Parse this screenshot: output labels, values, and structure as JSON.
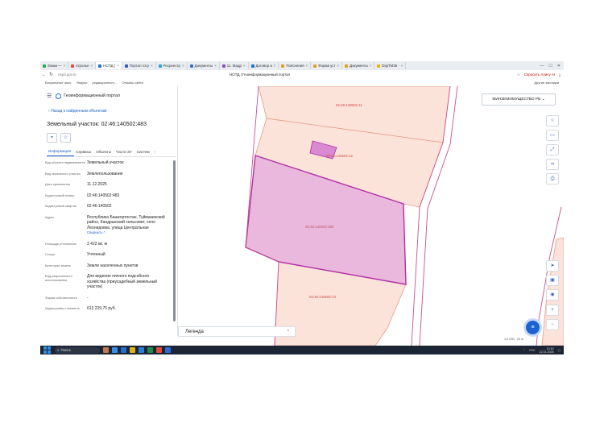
{
  "browser": {
    "tabs": [
      {
        "label": "Знаки —",
        "color": "#2ca84a",
        "active": false
      },
      {
        "label": "нтрольн",
        "color": "#e44b3a",
        "active": false
      },
      {
        "label": "НСПД |",
        "color": "#1e6fd0",
        "active": true
      },
      {
        "label": "Портал госу",
        "color": "#2d5fb8",
        "active": false
      },
      {
        "label": "Росреестр",
        "color": "#2d9ee0",
        "active": false
      },
      {
        "label": "Документы",
        "color": "#3a6fc4",
        "active": false
      },
      {
        "label": "11. Мадр",
        "color": "#8a4fc4",
        "active": false
      },
      {
        "label": "Договор а",
        "color": "#1e6fd0",
        "active": false
      },
      {
        "label": "Пояснения",
        "color": "#e0a21c",
        "active": false
      },
      {
        "label": "Форма уст",
        "color": "#e0a21c",
        "active": false
      },
      {
        "label": "Документы",
        "color": "#e0a21c",
        "active": false
      },
      {
        "label": "DigiTM38 ·",
        "color": "#f0b400",
        "active": false
      }
    ],
    "url": "nspd.gov.ru",
    "page_title": "НСПД | Геоинформационный портал",
    "alice": "Спросить Алису AI",
    "bookmarks": [
      "Визуальные закл.",
      "Яндекс",
      "редакционного...",
      "Отзывы сайта"
    ],
    "bookmarks_right": "Другие закладки"
  },
  "panel": {
    "portal_name": "Геоинформационный портал",
    "back_link": "Назад к найденным объектам",
    "parcel_title": "Земельный участок: 02:46:140502:483",
    "tabs": [
      "Информация",
      "Сервисы",
      "Объекты",
      "Части ЗУ",
      "Систем"
    ],
    "properties": [
      {
        "key": "Вид объекта недвижимости",
        "value": "Земельный участок"
      },
      {
        "key": "Вид земельного участка",
        "value": "Землепользование"
      },
      {
        "key": "Дата присвоения",
        "value": "11.12.2025"
      },
      {
        "key": "Кадастровый номер",
        "value": "02:46:140502:483"
      },
      {
        "key": "Кадастровый квартал",
        "value": "02:46:140502"
      },
      {
        "key": "Адрес",
        "value": "Республика Башкортостан, Туймазинский район, Кандрыкский сельсовет, село Леонидовка, улица Центральная",
        "more": "Свернуть ^"
      },
      {
        "key": "Площадь уточненная",
        "value": "3 422 кв. м"
      },
      {
        "key": "Статус",
        "value": "Учтенный"
      },
      {
        "key": "Категория земель",
        "value": "Земли населенных пунктов"
      },
      {
        "key": "Вид разрешенного использования",
        "value": "Для ведения личного подсобного хозяйства (приусадебный земельный участок)"
      },
      {
        "key": "Форма собственности",
        "value": "-"
      },
      {
        "key": "Кадастровая стоимость",
        "value": "613 229,75 руб."
      }
    ]
  },
  "map": {
    "ministry_select": "МИНЗЕМИМУЩЕСТВО РБ",
    "parcel_labels": [
      "02:46:140502:11",
      "02:46:140502:12",
      "02:46:140502:483",
      "02:46:140502:13"
    ],
    "legend": "Легенда",
    "scale": "1:2 000 · 20 м"
  },
  "taskbar": {
    "search": "Поиск",
    "lang": "РУС",
    "time": "10:10",
    "date": "12.01.2026"
  },
  "colors": {
    "parcel_fill": "#fbe3d9",
    "parcel_stroke": "#e79b88",
    "selected_fill": "#e9b8dc",
    "selected_stroke": "#b12ea7",
    "accent": "#1c63d1"
  }
}
